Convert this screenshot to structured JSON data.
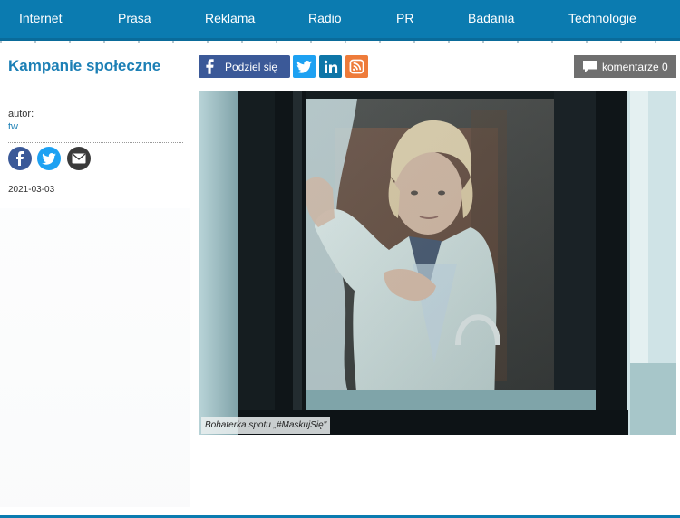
{
  "nav": {
    "items": [
      "Internet",
      "Prasa",
      "Reklama",
      "Radio",
      "PR",
      "Badania",
      "Technologie"
    ]
  },
  "article": {
    "category": "Kampanie społeczne",
    "author_label": "autor:",
    "author": "tw",
    "date": "2021-03-03"
  },
  "share": {
    "facebook_label": "Podziel się",
    "comments_label": "komentarze 0"
  },
  "photo": {
    "caption": "Bohaterka spotu „#MaskujSię\""
  },
  "colors": {
    "nav": "#0b7bb0",
    "accent": "#1b7fb5",
    "facebook": "#3b5998",
    "twitter": "#1da1f2",
    "linkedin": "#0e76a8",
    "wykop": "#ee7b3a",
    "comments": "#6f6f6f"
  },
  "icons": [
    "facebook-icon",
    "twitter-icon",
    "linkedin-icon",
    "wykop-icon",
    "mail-icon",
    "comment-icon"
  ]
}
